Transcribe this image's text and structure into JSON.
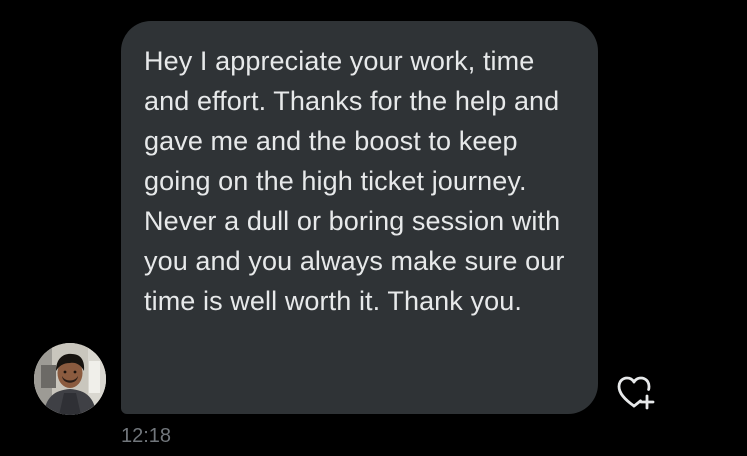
{
  "conversation": {
    "message": {
      "text": "Hey I appreciate your work, time and effort. Thanks for the help and gave me and the boost to keep going on the high ticket journey. Never a dull or boring session with you and you always make sure our time is well worth it. Thank you.",
      "timestamp": "12:18",
      "bubble_color": "#2f3336",
      "text_color": "#e7e9ea",
      "timestamp_color": "#71767b"
    },
    "sender": {
      "avatar_icon": "user-avatar-photo"
    },
    "actions": {
      "react_icon": "heart-plus-icon"
    }
  },
  "theme": {
    "background": "#000000"
  }
}
